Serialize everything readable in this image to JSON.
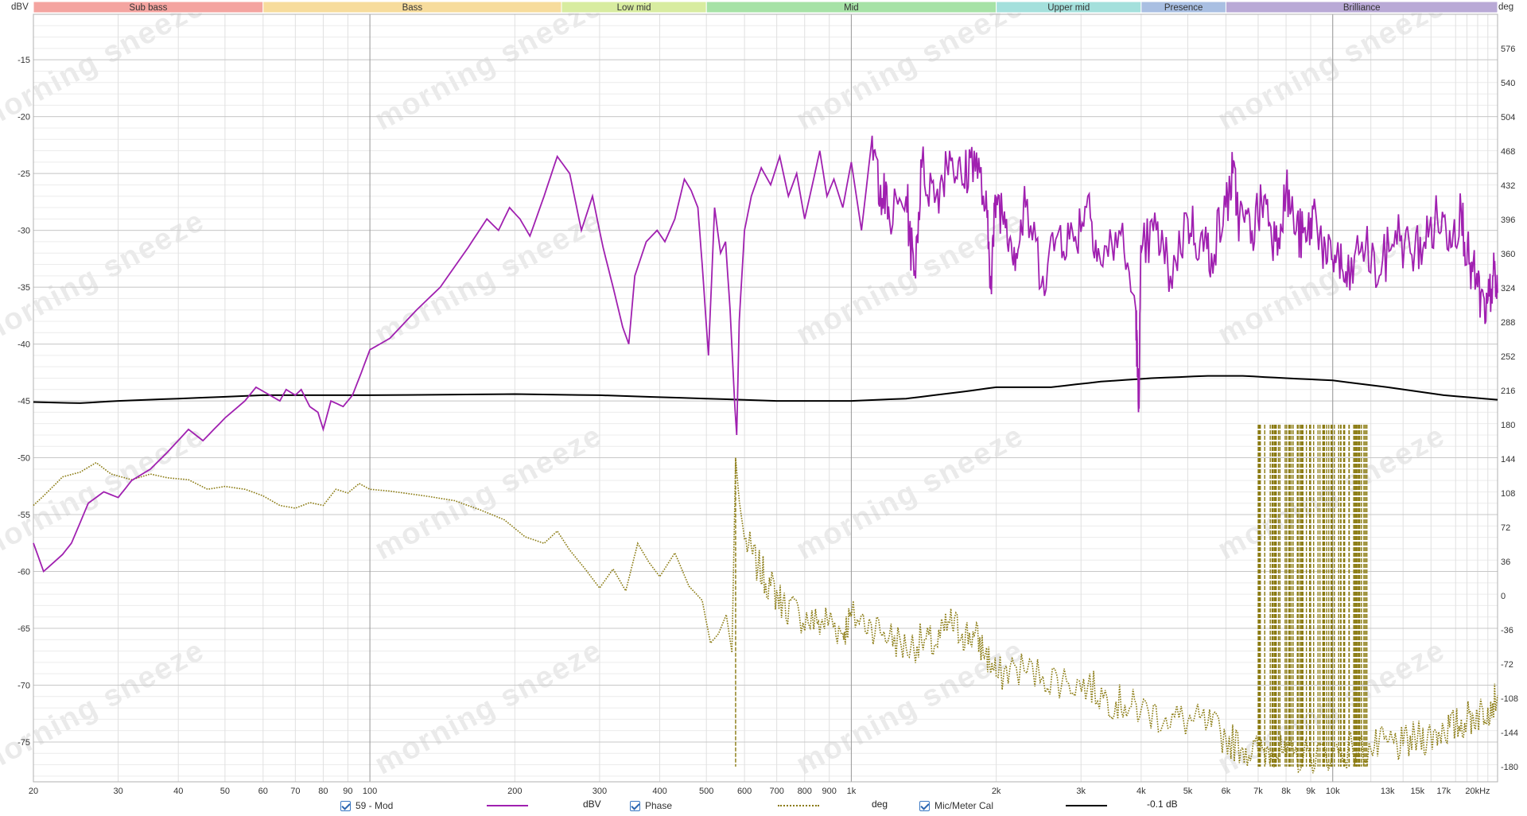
{
  "chart_data": {
    "type": "line",
    "x_scale": "log",
    "xlim_hz": [
      20,
      22000
    ],
    "ylim_dbv": [
      -78.5,
      -11
    ],
    "ylim_deg": [
      -196,
      612
    ],
    "grid": true,
    "left_axis_unit": "dBV",
    "right_axis_unit": "deg",
    "x_ticks": [
      {
        "hz": 20,
        "label": "20"
      },
      {
        "hz": 30,
        "label": "30"
      },
      {
        "hz": 40,
        "label": "40"
      },
      {
        "hz": 50,
        "label": "50"
      },
      {
        "hz": 60,
        "label": "60"
      },
      {
        "hz": 70,
        "label": "70"
      },
      {
        "hz": 80,
        "label": "80"
      },
      {
        "hz": 90,
        "label": "90"
      },
      {
        "hz": 100,
        "label": "100"
      },
      {
        "hz": 200,
        "label": "200"
      },
      {
        "hz": 300,
        "label": "300"
      },
      {
        "hz": 400,
        "label": "400"
      },
      {
        "hz": 500,
        "label": "500"
      },
      {
        "hz": 600,
        "label": "600"
      },
      {
        "hz": 700,
        "label": "700"
      },
      {
        "hz": 800,
        "label": "800"
      },
      {
        "hz": 900,
        "label": "900"
      },
      {
        "hz": 1000,
        "label": "1k"
      },
      {
        "hz": 2000,
        "label": "2k"
      },
      {
        "hz": 3000,
        "label": "3k"
      },
      {
        "hz": 4000,
        "label": "4k"
      },
      {
        "hz": 5000,
        "label": "5k"
      },
      {
        "hz": 6000,
        "label": "6k"
      },
      {
        "hz": 7000,
        "label": "7k"
      },
      {
        "hz": 8000,
        "label": "8k"
      },
      {
        "hz": 9000,
        "label": "9k"
      },
      {
        "hz": 10000,
        "label": "10k"
      },
      {
        "hz": 13000,
        "label": "13k"
      },
      {
        "hz": 15000,
        "label": "15k"
      },
      {
        "hz": 17000,
        "label": "17k"
      },
      {
        "hz": 20000,
        "label": "20kHz"
      }
    ],
    "y_left_ticks": [
      -15,
      -20,
      -25,
      -30,
      -35,
      -40,
      -45,
      -50,
      -55,
      -60,
      -65,
      -70,
      -75
    ],
    "y_right_ticks": [
      576,
      540,
      504,
      468,
      432,
      396,
      360,
      324,
      288,
      252,
      216,
      180,
      144,
      108,
      72,
      36,
      0,
      -36,
      -72,
      -108,
      -144,
      -180
    ],
    "bands": [
      {
        "label": "Sub bass",
        "from": 20,
        "to": 60,
        "color": "#f4a4a0"
      },
      {
        "label": "Bass",
        "from": 60,
        "to": 250,
        "color": "#f7dc9c"
      },
      {
        "label": "Low mid",
        "from": 250,
        "to": 500,
        "color": "#d8eca0"
      },
      {
        "label": "Mid",
        "from": 500,
        "to": 2000,
        "color": "#a6e2a6"
      },
      {
        "label": "Upper mid",
        "from": 2000,
        "to": 4000,
        "color": "#a4e0dc"
      },
      {
        "label": "Presence",
        "from": 4000,
        "to": 6000,
        "color": "#a9bfe2"
      },
      {
        "label": "Brilliance",
        "from": 6000,
        "to": 22000,
        "color": "#b9a9d6"
      }
    ],
    "series": [
      {
        "name": "59 - Mod",
        "unit": "dBV",
        "axis": "left",
        "color": "#a020b0",
        "style": "solid",
        "points": [
          [
            20,
            -57.5
          ],
          [
            21,
            -60
          ],
          [
            23,
            -58.5
          ],
          [
            24,
            -57.5
          ],
          [
            26,
            -54
          ],
          [
            28,
            -53
          ],
          [
            30,
            -53.5
          ],
          [
            32,
            -52
          ],
          [
            35,
            -51
          ],
          [
            38,
            -49.5
          ],
          [
            42,
            -47.5
          ],
          [
            45,
            -48.5
          ],
          [
            50,
            -46.5
          ],
          [
            55,
            -45
          ],
          [
            58,
            -43.8
          ],
          [
            62,
            -44.5
          ],
          [
            65,
            -45
          ],
          [
            67,
            -44
          ],
          [
            70,
            -44.5
          ],
          [
            72,
            -44
          ],
          [
            75,
            -45.5
          ],
          [
            78,
            -46
          ],
          [
            80,
            -47.5
          ],
          [
            83,
            -45
          ],
          [
            88,
            -45.5
          ],
          [
            92,
            -44.5
          ],
          [
            96,
            -42.5
          ],
          [
            100,
            -40.5
          ],
          [
            110,
            -39.5
          ],
          [
            125,
            -37
          ],
          [
            140,
            -35
          ],
          [
            160,
            -31.5
          ],
          [
            175,
            -29
          ],
          [
            185,
            -30
          ],
          [
            195,
            -28
          ],
          [
            205,
            -29
          ],
          [
            215,
            -30.5
          ],
          [
            230,
            -27
          ],
          [
            245,
            -23.5
          ],
          [
            260,
            -25
          ],
          [
            275,
            -30
          ],
          [
            290,
            -27
          ],
          [
            305,
            -31.5
          ],
          [
            320,
            -35
          ],
          [
            335,
            -38.5
          ],
          [
            345,
            -40
          ],
          [
            355,
            -34
          ],
          [
            375,
            -31
          ],
          [
            395,
            -30
          ],
          [
            410,
            -31
          ],
          [
            430,
            -29
          ],
          [
            450,
            -25.5
          ],
          [
            465,
            -26.5
          ],
          [
            480,
            -28
          ],
          [
            490,
            -33
          ],
          [
            505,
            -41
          ],
          [
            520,
            -28
          ],
          [
            535,
            -32
          ],
          [
            548,
            -31
          ],
          [
            560,
            -37
          ],
          [
            572,
            -45
          ],
          [
            578,
            -48
          ],
          [
            585,
            -38
          ],
          [
            600,
            -30
          ],
          [
            620,
            -27
          ],
          [
            650,
            -24.5
          ],
          [
            680,
            -26
          ],
          [
            710,
            -23.5
          ],
          [
            740,
            -27
          ],
          [
            770,
            -25
          ],
          [
            800,
            -29
          ],
          [
            830,
            -26
          ],
          [
            860,
            -23
          ],
          [
            890,
            -27
          ],
          [
            920,
            -25.5
          ],
          [
            960,
            -28
          ],
          [
            1000,
            -24
          ],
          [
            1050,
            -30
          ],
          [
            1100,
            -22.5
          ],
          [
            1150,
            -26
          ],
          [
            1200,
            -29
          ],
          [
            1300,
            -27
          ],
          [
            1350,
            -34
          ],
          [
            1400,
            -24.5
          ],
          [
            1500,
            -27
          ],
          [
            1600,
            -23
          ],
          [
            1700,
            -26
          ],
          [
            1800,
            -23
          ],
          [
            1900,
            -28
          ],
          [
            1950,
            -34
          ],
          [
            2000,
            -27
          ],
          [
            2100,
            -29
          ],
          [
            2200,
            -32
          ],
          [
            2300,
            -28
          ],
          [
            2500,
            -34
          ],
          [
            2700,
            -30
          ],
          [
            2900,
            -31
          ],
          [
            3100,
            -27
          ],
          [
            3300,
            -33
          ],
          [
            3600,
            -30
          ],
          [
            3900,
            -37
          ],
          [
            3950,
            -46
          ],
          [
            4000,
            -32
          ],
          [
            4300,
            -30
          ],
          [
            4600,
            -34
          ],
          [
            5000,
            -29
          ],
          [
            5300,
            -31
          ],
          [
            5600,
            -32
          ],
          [
            6000,
            -28
          ],
          [
            6200,
            -25
          ],
          [
            6400,
            -29
          ],
          [
            6800,
            -30
          ],
          [
            7200,
            -27
          ],
          [
            7600,
            -31
          ],
          [
            8000,
            -26.5
          ],
          [
            8400,
            -30
          ],
          [
            8800,
            -31
          ],
          [
            9200,
            -28
          ],
          [
            9700,
            -33
          ],
          [
            10200,
            -32
          ],
          [
            10700,
            -35
          ],
          [
            11500,
            -31
          ],
          [
            12500,
            -34
          ],
          [
            13500,
            -30
          ],
          [
            14500,
            -32
          ],
          [
            15500,
            -31
          ],
          [
            16500,
            -29
          ],
          [
            17500,
            -30
          ],
          [
            18500,
            -28.5
          ],
          [
            19200,
            -33
          ],
          [
            20000,
            -35
          ],
          [
            20800,
            -38
          ],
          [
            21500,
            -34
          ],
          [
            22000,
            -35.5
          ]
        ]
      },
      {
        "name": "Phase",
        "unit": "deg",
        "axis": "right",
        "color": "#8a7a10",
        "style": "dotted",
        "points": [
          [
            20,
            95
          ],
          [
            21,
            105
          ],
          [
            23,
            125
          ],
          [
            25,
            130
          ],
          [
            27,
            140
          ],
          [
            29,
            128
          ],
          [
            32,
            122
          ],
          [
            35,
            128
          ],
          [
            38,
            124
          ],
          [
            42,
            122
          ],
          [
            46,
            112
          ],
          [
            50,
            115
          ],
          [
            55,
            112
          ],
          [
            60,
            105
          ],
          [
            65,
            95
          ],
          [
            70,
            92
          ],
          [
            75,
            98
          ],
          [
            80,
            95
          ],
          [
            85,
            112
          ],
          [
            90,
            108
          ],
          [
            95,
            118
          ],
          [
            100,
            112
          ],
          [
            110,
            110
          ],
          [
            130,
            105
          ],
          [
            150,
            100
          ],
          [
            170,
            90
          ],
          [
            190,
            80
          ],
          [
            210,
            62
          ],
          [
            230,
            55
          ],
          [
            245,
            68
          ],
          [
            260,
            48
          ],
          [
            280,
            28
          ],
          [
            300,
            8
          ],
          [
            320,
            28
          ],
          [
            340,
            5
          ],
          [
            360,
            55
          ],
          [
            380,
            35
          ],
          [
            400,
            20
          ],
          [
            430,
            45
          ],
          [
            460,
            10
          ],
          [
            490,
            -5
          ],
          [
            510,
            -50
          ],
          [
            530,
            -40
          ],
          [
            550,
            -20
          ],
          [
            565,
            -60
          ],
          [
            575,
            145
          ],
          [
            585,
            100
          ],
          [
            600,
            60
          ],
          [
            640,
            30
          ],
          [
            680,
            10
          ],
          [
            720,
            -8
          ],
          [
            780,
            -20
          ],
          [
            850,
            -30
          ],
          [
            900,
            -25
          ],
          [
            960,
            -40
          ],
          [
            1000,
            -22
          ],
          [
            1100,
            -30
          ],
          [
            1200,
            -42
          ],
          [
            1300,
            -55
          ],
          [
            1400,
            -48
          ],
          [
            1500,
            -52
          ],
          [
            1600,
            -28
          ],
          [
            1700,
            -40
          ],
          [
            1800,
            -42
          ],
          [
            1900,
            -60
          ],
          [
            2000,
            -85
          ],
          [
            2200,
            -75
          ],
          [
            2500,
            -85
          ],
          [
            2800,
            -90
          ],
          [
            3100,
            -95
          ],
          [
            3400,
            -108
          ],
          [
            3700,
            -115
          ],
          [
            4000,
            -120
          ],
          [
            4500,
            -128
          ],
          [
            5000,
            -132
          ],
          [
            5500,
            -135
          ],
          [
            6000,
            -150
          ],
          [
            6500,
            -160
          ],
          [
            7000,
            -165
          ],
          [
            7500,
            -160
          ],
          [
            8000,
            -170
          ],
          [
            9000,
            -168
          ],
          [
            10000,
            -165
          ],
          [
            11000,
            -162
          ],
          [
            12000,
            -162
          ],
          [
            13000,
            -155
          ],
          [
            14000,
            -158
          ],
          [
            15000,
            -150
          ],
          [
            16000,
            -148
          ],
          [
            17000,
            -140
          ],
          [
            18000,
            -138
          ],
          [
            19000,
            -130
          ],
          [
            20000,
            -125
          ],
          [
            21000,
            -118
          ],
          [
            22000,
            -105
          ]
        ]
      },
      {
        "name": "Mic/Meter Cal",
        "unit": "-0.1 dB",
        "axis": "left",
        "color": "#000000",
        "style": "solid",
        "points": [
          [
            20,
            -45.1
          ],
          [
            25,
            -45.2
          ],
          [
            30,
            -45.0
          ],
          [
            40,
            -44.8
          ],
          [
            60,
            -44.5
          ],
          [
            100,
            -44.5
          ],
          [
            200,
            -44.4
          ],
          [
            300,
            -44.5
          ],
          [
            500,
            -44.8
          ],
          [
            700,
            -45.0
          ],
          [
            1000,
            -45.0
          ],
          [
            1300,
            -44.8
          ],
          [
            1700,
            -44.2
          ],
          [
            2000,
            -43.8
          ],
          [
            2600,
            -43.8
          ],
          [
            3300,
            -43.3
          ],
          [
            4200,
            -43.0
          ],
          [
            5500,
            -42.8
          ],
          [
            6500,
            -42.8
          ],
          [
            8000,
            -43.0
          ],
          [
            10000,
            -43.2
          ],
          [
            13000,
            -43.8
          ],
          [
            17000,
            -44.5
          ],
          [
            22000,
            -44.9
          ]
        ]
      }
    ],
    "phase_wrap_region_hz": [
      7000,
      11800
    ]
  },
  "legend": {
    "items": [
      {
        "checked": true,
        "label": "59 - Mod",
        "unit": "dBV",
        "color": "#a020b0",
        "style": "solid"
      },
      {
        "checked": true,
        "label": "Phase",
        "unit": "deg",
        "color": "#8a7a10",
        "style": "dotted"
      },
      {
        "checked": true,
        "label": "Mic/Meter Cal",
        "unit": "-0.1 dB",
        "color": "#000000",
        "style": "solid"
      }
    ]
  },
  "watermark": {
    "text": "morning sneeze"
  }
}
